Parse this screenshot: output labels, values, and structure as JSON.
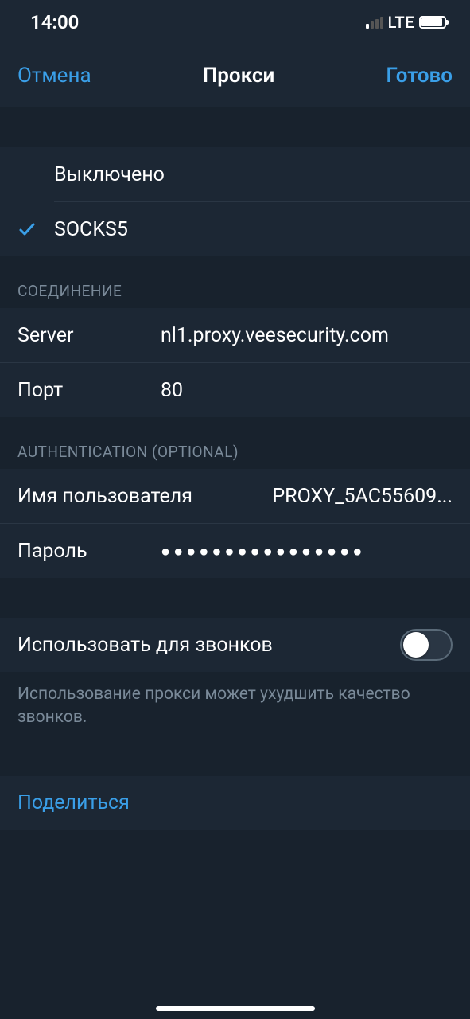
{
  "status": {
    "time": "14:00",
    "network": "LTE"
  },
  "nav": {
    "cancel": "Отмена",
    "title": "Прокси",
    "done": "Готово"
  },
  "type": {
    "disabled": "Выключено",
    "socks5": "SOCKS5"
  },
  "connection": {
    "header": "СОЕДИНЕНИЕ",
    "server_label": "Server",
    "server_value": "nl1.proxy.veesecurity.com",
    "port_label": "Порт",
    "port_value": "80"
  },
  "auth": {
    "header": "AUTHENTICATION (OPTIONAL)",
    "username_label": "Имя пользователя",
    "username_value": "PROXY_5AC55609...",
    "password_label": "Пароль",
    "password_masked": "●●●●●●●●●●●●●●●●"
  },
  "calls": {
    "label": "Использовать для звонков",
    "note": "Использование прокси может ухудшить качество звонков."
  },
  "share": {
    "label": "Поделиться"
  }
}
